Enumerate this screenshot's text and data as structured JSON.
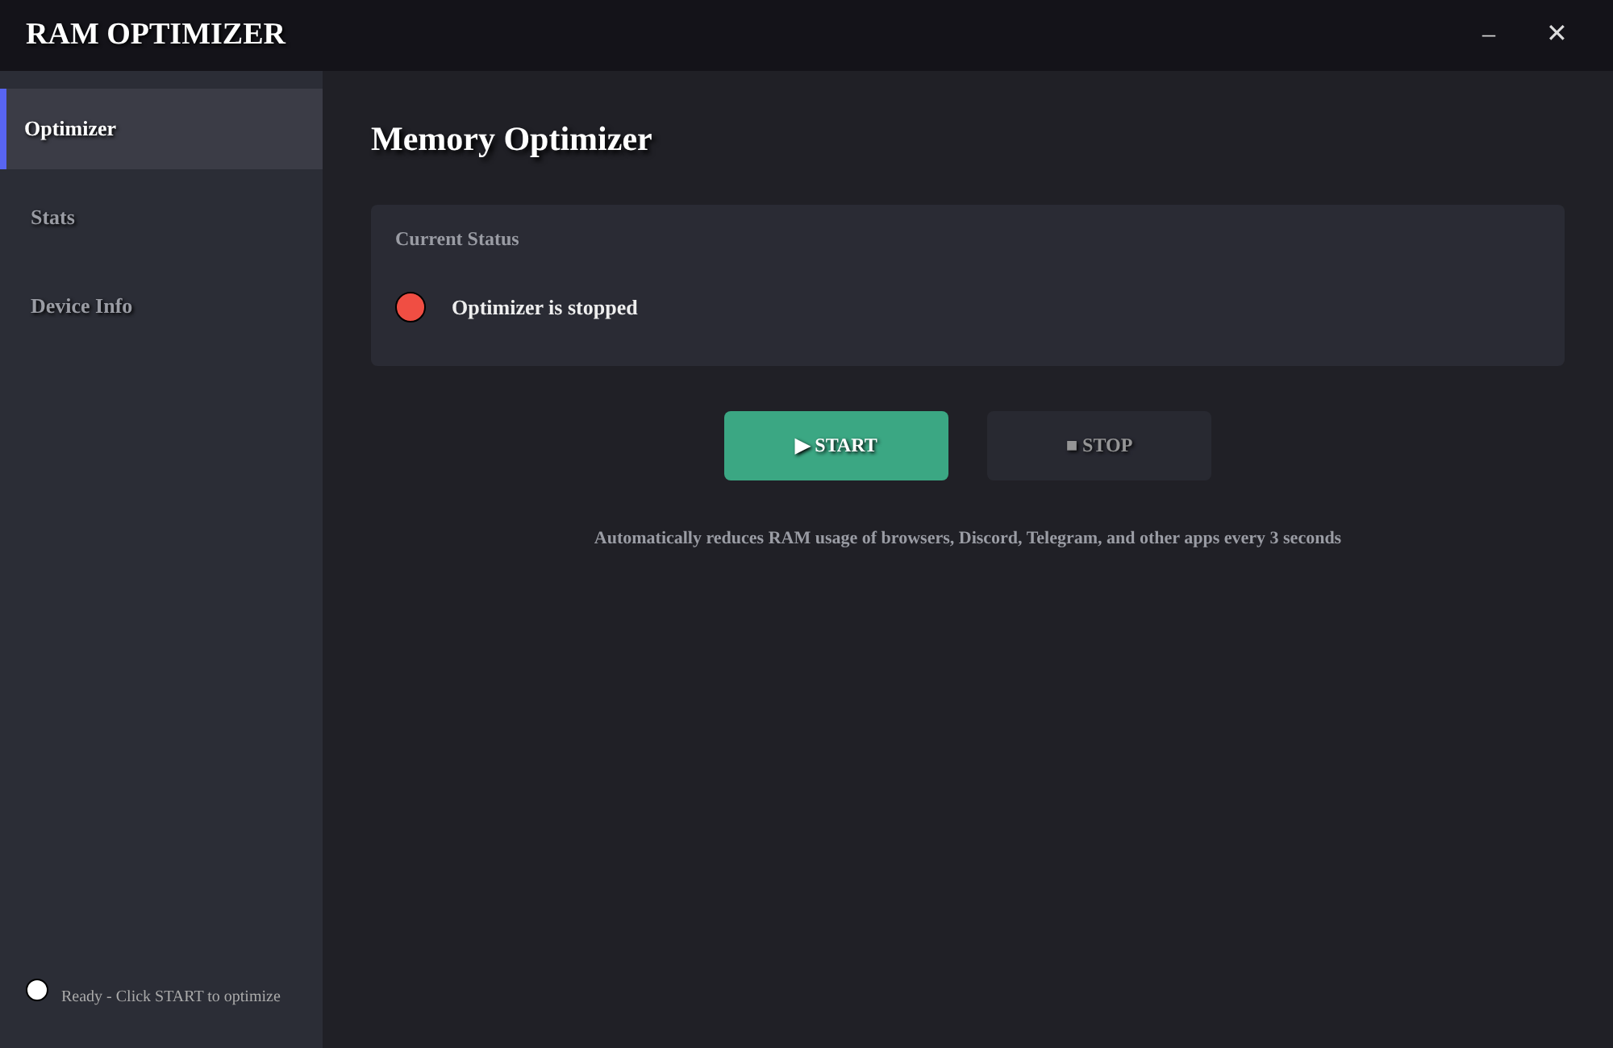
{
  "window": {
    "title": "RAM OPTIMIZER",
    "controls": [
      "–",
      "✕"
    ]
  },
  "sidebar": {
    "items": [
      {
        "label": "Optimizer",
        "selected": true
      },
      {
        "label": "Stats",
        "selected": false
      },
      {
        "label": "Device Info",
        "selected": false
      }
    ],
    "footer": "Ready - Click START to optimize"
  },
  "main": {
    "heading": "Memory Optimizer",
    "status": {
      "title": "Current Status",
      "text": "Optimizer is stopped",
      "running": false
    },
    "buttons": [
      {
        "kind": "start",
        "label": "▶ START",
        "disabled": false
      },
      {
        "kind": "stop",
        "label": "■ STOP",
        "disabled": true
      }
    ],
    "note": "Automatically reduces RAM usage of browsers, Discord, Telegram, and other apps every 3 seconds"
  }
}
